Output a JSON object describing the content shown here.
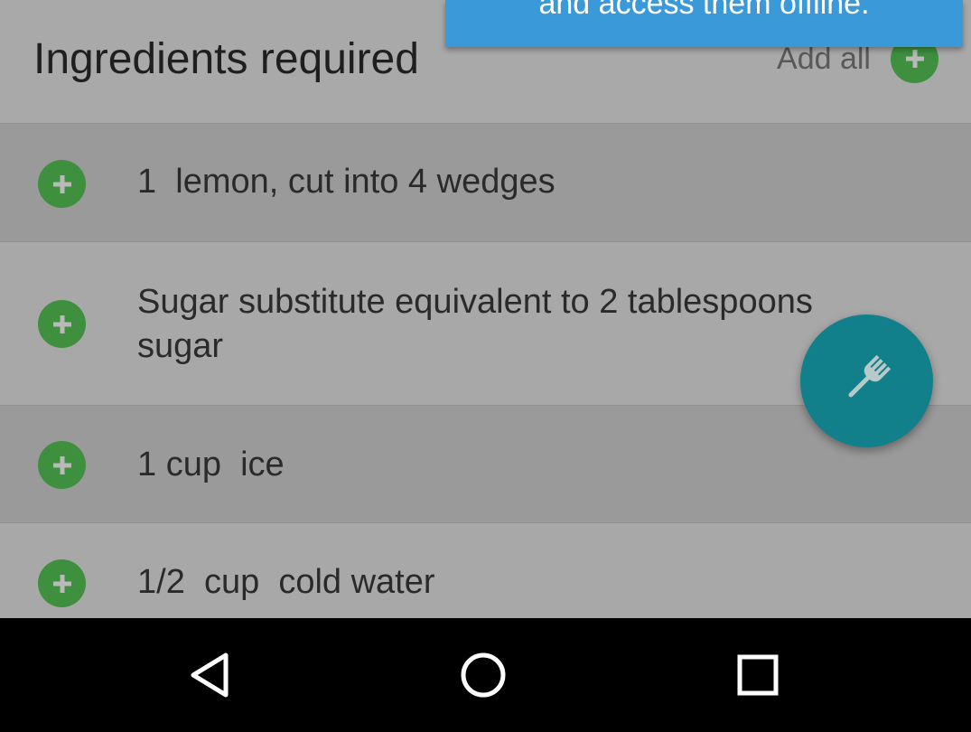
{
  "toast": {
    "text": "and access them offline."
  },
  "header": {
    "title": "Ingredients required",
    "add_all_label": "Add all",
    "add_all_icon": "plus-icon"
  },
  "ingredients": [
    {
      "text": "1  lemon, cut into 4 wedges"
    },
    {
      "text": "Sugar substitute equivalent to 2 tablespoons sugar"
    },
    {
      "text": "1 cup  ice"
    },
    {
      "text": "1/2  cup  cold water"
    }
  ],
  "fab": {
    "icon": "fork-icon",
    "color": "#12808a"
  },
  "navbar": {
    "back_icon": "back-triangle-icon",
    "home_icon": "home-circle-icon",
    "recents_icon": "recents-square-icon"
  },
  "colors": {
    "accent_green": "#3e8f3e",
    "toast_blue": "#3a9ad9",
    "fab_teal": "#12808a"
  }
}
